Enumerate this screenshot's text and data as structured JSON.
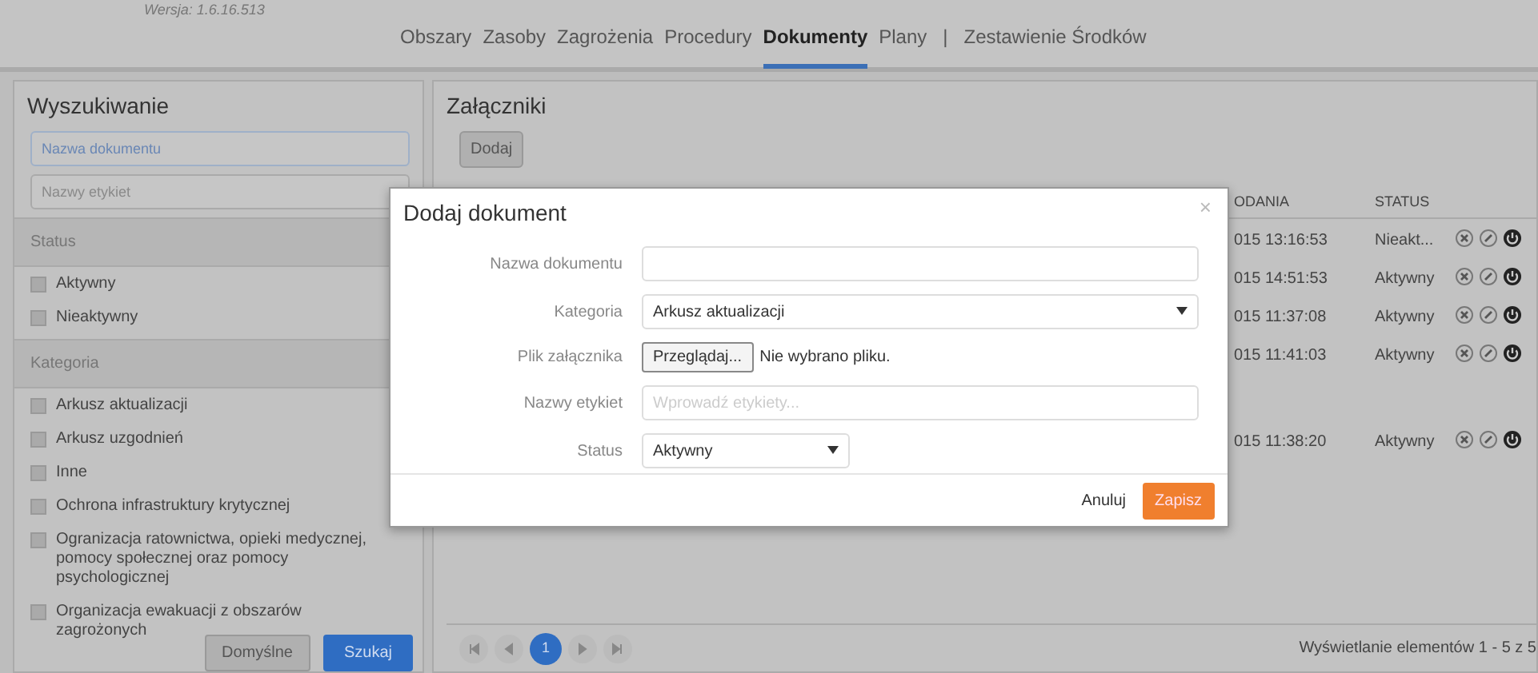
{
  "version": "Wersja: 1.6.16.513",
  "nav": [
    {
      "label": "Obszary",
      "selected": false
    },
    {
      "label": "Zasoby",
      "selected": false
    },
    {
      "label": "Zagrożenia",
      "selected": false
    },
    {
      "label": "Procedury",
      "selected": false
    },
    {
      "label": "Dokumenty",
      "selected": true
    },
    {
      "label": "Plany",
      "selected": false
    },
    {
      "label": "|",
      "kind": "separator"
    },
    {
      "label": "Zestawienie Środków",
      "selected": false
    }
  ],
  "search": {
    "title": "Wyszukiwanie",
    "fields": [
      {
        "placeholder": "Nazwa dokumentu",
        "focused": true
      },
      {
        "placeholder": "Nazwy etykiet",
        "focused": false
      }
    ],
    "groups": [
      {
        "title": "Status",
        "options": [
          {
            "label": "Aktywny",
            "checked": false
          },
          {
            "label": "Nieaktywny",
            "checked": false
          }
        ]
      },
      {
        "title": "Kategoria",
        "options": [
          {
            "label": "Arkusz aktualizacji",
            "checked": false
          },
          {
            "label": "Arkusz uzgodnień",
            "checked": false
          },
          {
            "label": "Inne",
            "checked": false
          },
          {
            "label": "Ochrona infrastruktury krytycznej",
            "checked": false
          },
          {
            "label": "Ogranizacja ratownictwa, opieki medycznej, pomocy społecznej oraz pomocy psychologicznej",
            "checked": false
          },
          {
            "label": "Organizacja ewakuacji z obszarów zagrożonych",
            "checked": false
          }
        ]
      }
    ],
    "buttons": [
      "Domyślne",
      "Szukaj"
    ]
  },
  "attachments": {
    "title": "Załączniki",
    "add_button": "Dodaj",
    "columns": [
      "ODANIA",
      "STATUS"
    ],
    "rows": [
      {
        "date": "015 13:16:53",
        "status": "Nieakt..."
      },
      {
        "date": "015 14:51:53",
        "status": "Aktywny"
      },
      {
        "date": "015 11:37:08",
        "status": "Aktywny"
      },
      {
        "date": "015 11:41:03",
        "status": "Aktywny"
      },
      {
        "date": "015 11:38:20",
        "status": "Aktywny"
      }
    ],
    "pager": {
      "pages": [
        {
          "label": "1",
          "selected": true
        }
      ],
      "summary": "Wyświetlanie elementów 1 - 5 z 5"
    }
  },
  "modal": {
    "title": "Dodaj dokument",
    "close": "×",
    "fields": [
      {
        "kind": "text",
        "label": "Nazwa dokumentu"
      },
      {
        "kind": "select",
        "label": "Kategoria",
        "value": "Arkusz aktualizacji"
      },
      {
        "kind": "file",
        "label": "Plik załącznika",
        "button": "Przeglądaj...",
        "value": "Nie wybrano pliku."
      },
      {
        "kind": "text",
        "label": "Nazwy etykiet",
        "placeholder": "Wprowadź etykiety..."
      },
      {
        "kind": "select-small",
        "label": "Status",
        "value": "Aktywny"
      }
    ],
    "buttons": [
      {
        "label": "Anuluj",
        "kind": "link"
      },
      {
        "label": "Zapisz",
        "kind": "primary"
      }
    ]
  }
}
